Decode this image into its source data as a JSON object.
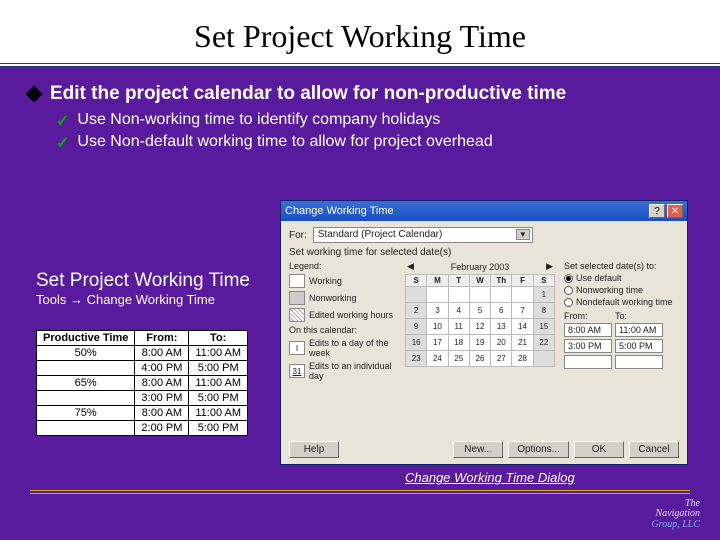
{
  "title": "Set Project Working Time",
  "bullet_main": "Edit the project calendar to allow for non-productive time",
  "sub1": "Use Non-working time to identify company holidays",
  "sub2": "Use Non-default working time to allow for project overhead",
  "left": {
    "heading": "Set Project Working Time",
    "path_a": "Tools ",
    "path_b": " Change Working Time"
  },
  "table": {
    "h1": "Productive Time",
    "h2": "From:",
    "h3": "To:",
    "r": [
      [
        "50%",
        "8:00 AM",
        "11:00 AM"
      ],
      [
        "",
        "4:00 PM",
        "5:00 PM"
      ],
      [
        "65%",
        "8:00 AM",
        "11:00 AM"
      ],
      [
        "",
        "3:00 PM",
        "5:00 PM"
      ],
      [
        "75%",
        "8:00 AM",
        "11:00 AM"
      ],
      [
        "",
        "2:00 PM",
        "5:00 PM"
      ]
    ]
  },
  "dialog": {
    "title": "Change Working Time",
    "for_label": "For:",
    "for_value": "Standard (Project Calendar)",
    "set_label": "Set working time for selected date(s)",
    "legend_label": "Legend:",
    "legend": {
      "working": "Working",
      "nonworking": "Nonworking",
      "edited": "Edited working hours",
      "oncal": "On this calendar:",
      "editday": "Edits to a day of the week",
      "indiv": "Edits to an individual day"
    },
    "cal": {
      "month": "February 2003",
      "days": [
        "S",
        "M",
        "T",
        "W",
        "Th",
        "F",
        "S"
      ]
    },
    "right": {
      "head": "Set selected date(s) to:",
      "r1": "Use default",
      "r2": "Nonworking time",
      "r3": "Nondefault working time",
      "from": "From:",
      "to": "To:",
      "f1": "8:00 AM",
      "t1": "11:00 AM",
      "f2": "3:00 PM",
      "t2": "5:00 PM"
    },
    "buttons": {
      "help": "Help",
      "new": "New...",
      "options": "Options...",
      "ok": "OK",
      "cancel": "Cancel"
    }
  },
  "caption": "Change Working Time Dialog",
  "logo": {
    "l1": "The",
    "l2": "Navigation",
    "l3": "Group, LLC"
  }
}
